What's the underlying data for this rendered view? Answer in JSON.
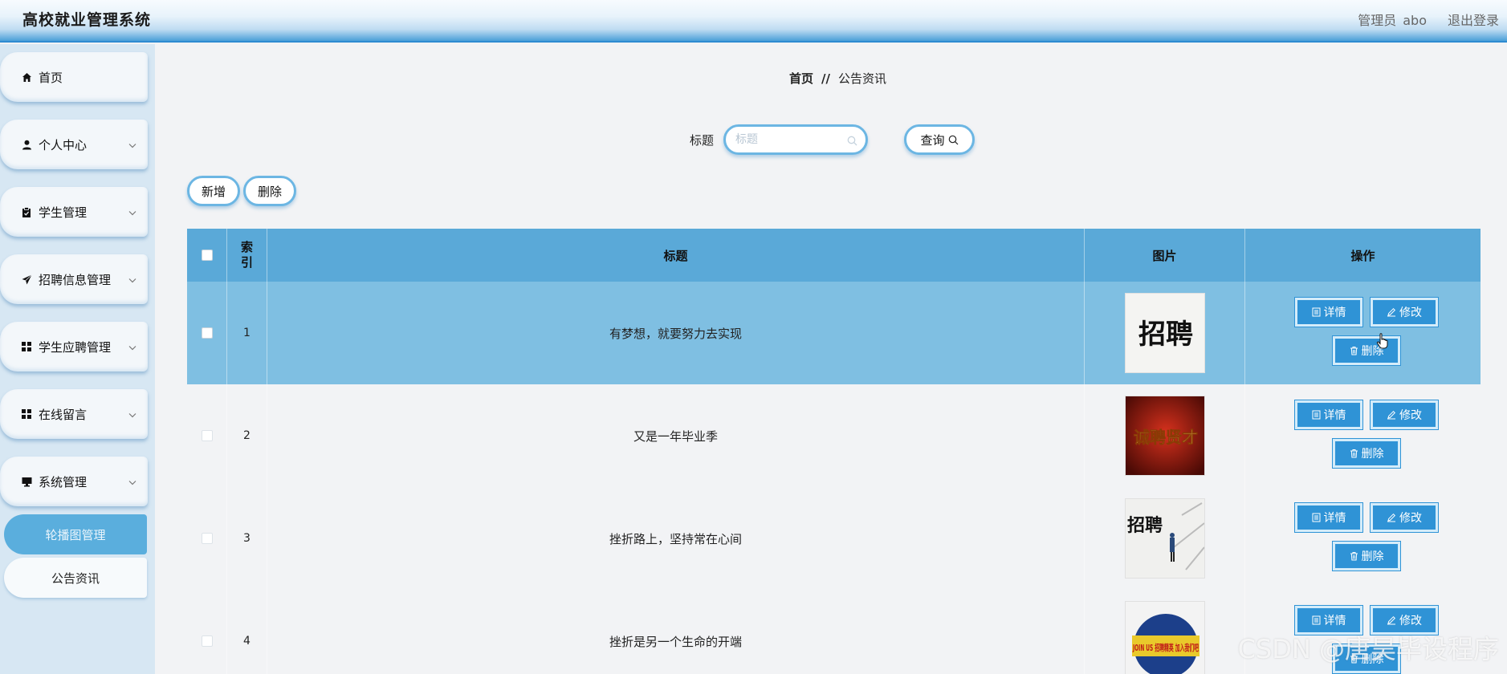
{
  "header": {
    "app_title": "高校就业管理系统",
    "role": "管理员",
    "username": "abo",
    "logout": "退出登录"
  },
  "sidebar": {
    "items": [
      {
        "label": "首页",
        "icon": "home-icon"
      },
      {
        "label": "个人中心",
        "icon": "user-icon"
      },
      {
        "label": "学生管理",
        "icon": "clipboard-icon"
      },
      {
        "label": "招聘信息管理",
        "icon": "paper-plane-icon"
      },
      {
        "label": "学生应聘管理",
        "icon": "grid-icon"
      },
      {
        "label": "在线留言",
        "icon": "grid-icon"
      },
      {
        "label": "系统管理",
        "icon": "monitor-icon"
      }
    ],
    "sub_items": [
      {
        "label": "轮播图管理",
        "active": true
      },
      {
        "label": "公告资讯",
        "active": false
      }
    ]
  },
  "breadcrumb": {
    "home": "首页",
    "sep": "//",
    "current": "公告资讯"
  },
  "search": {
    "label": "标题",
    "placeholder": "标题",
    "button": "查询"
  },
  "toolbar": {
    "add": "新增",
    "delete": "删除"
  },
  "table": {
    "columns": {
      "index": "索引",
      "title": "标题",
      "image": "图片",
      "actions": "操作"
    },
    "rows": [
      {
        "index": "1",
        "title": "有梦想，就要努力去实现",
        "image": "招聘",
        "selected": true
      },
      {
        "index": "2",
        "title": "又是一年毕业季",
        "image": "诚聘贤才",
        "selected": false
      },
      {
        "index": "3",
        "title": "挫折路上，坚持常在心间",
        "image": "招聘",
        "selected": false
      },
      {
        "index": "4",
        "title": "挫折是另一个生命的开端",
        "image": "JOIN US 招聘精英 加入我们吧",
        "selected": false
      }
    ],
    "actions": {
      "detail": "详情",
      "edit": "修改",
      "delete": "删除"
    }
  },
  "watermark": "CSDN @唐昊毕设程序",
  "colors": {
    "accent": "#2f93d6",
    "header_row": "#5aa9d8",
    "selected_row": "#7fbfe2",
    "active_sub": "#5aaedd"
  }
}
